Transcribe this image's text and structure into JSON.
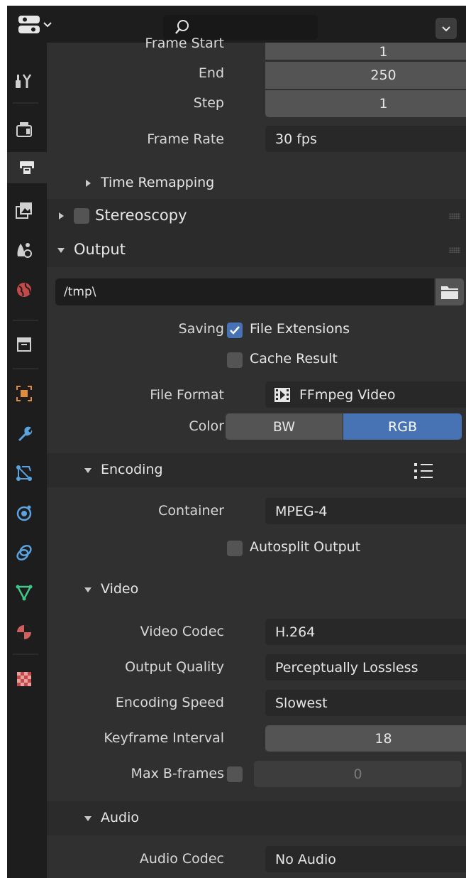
{
  "header": {
    "search_placeholder": ""
  },
  "sidebar": {
    "tabs": [
      {
        "name": "tool-tab",
        "icon": "tool-icon"
      },
      {
        "name": "render-tab",
        "icon": "render-icon"
      },
      {
        "name": "output-tab",
        "icon": "printer-icon",
        "active": true
      },
      {
        "name": "view-layer-tab",
        "icon": "view-layer-icon"
      },
      {
        "name": "scene-tab",
        "icon": "scene-icon"
      },
      {
        "name": "world-tab",
        "icon": "world-icon"
      },
      {
        "name": "collection-tab",
        "icon": "collection-icon"
      },
      {
        "name": "object-tab",
        "icon": "object-icon"
      },
      {
        "name": "modifier-tab",
        "icon": "wrench-icon"
      },
      {
        "name": "particles-tab",
        "icon": "particles-icon"
      },
      {
        "name": "physics-tab",
        "icon": "physics-icon"
      },
      {
        "name": "constraints-tab",
        "icon": "constraint-icon"
      },
      {
        "name": "data-tab",
        "icon": "mesh-data-icon"
      },
      {
        "name": "material-tab",
        "icon": "material-icon"
      },
      {
        "name": "texture-tab",
        "icon": "texture-icon"
      }
    ]
  },
  "frame_range": {
    "start_label": "Frame Start",
    "start_value": "1",
    "end_label": "End",
    "end_value": "250",
    "step_label": "Step",
    "step_value": "1"
  },
  "frame_rate": {
    "label": "Frame Rate",
    "value": "30 fps"
  },
  "time_remapping": {
    "label": "Time Remapping"
  },
  "stereoscopy": {
    "label": "Stereoscopy"
  },
  "output": {
    "label": "Output",
    "path": "/tmp\\",
    "saving_label": "Saving",
    "file_extensions_label": "File Extensions",
    "file_extensions_checked": true,
    "cache_result_label": "Cache Result",
    "cache_result_checked": false,
    "file_format_label": "File Format",
    "file_format_value": "FFmpeg Video",
    "color_label": "Color",
    "color_options": [
      "BW",
      "RGB"
    ],
    "color_selected": "RGB"
  },
  "encoding": {
    "label": "Encoding",
    "container_label": "Container",
    "container_value": "MPEG-4",
    "autosplit_label": "Autosplit Output",
    "autosplit_checked": false
  },
  "video": {
    "label": "Video",
    "codec_label": "Video Codec",
    "codec_value": "H.264",
    "quality_label": "Output Quality",
    "quality_value": "Perceptually Lossless",
    "speed_label": "Encoding Speed",
    "speed_value": "Slowest",
    "keyframe_label": "Keyframe Interval",
    "keyframe_value": "18",
    "bframes_label": "Max B-frames",
    "bframes_value": "0",
    "bframes_checked": false
  },
  "audio": {
    "label": "Audio",
    "codec_label": "Audio Codec",
    "codec_value": "No Audio"
  },
  "colors": {
    "accent": "#4772b3",
    "panel_bg": "#303030",
    "header_bg": "#1d1d1d"
  }
}
